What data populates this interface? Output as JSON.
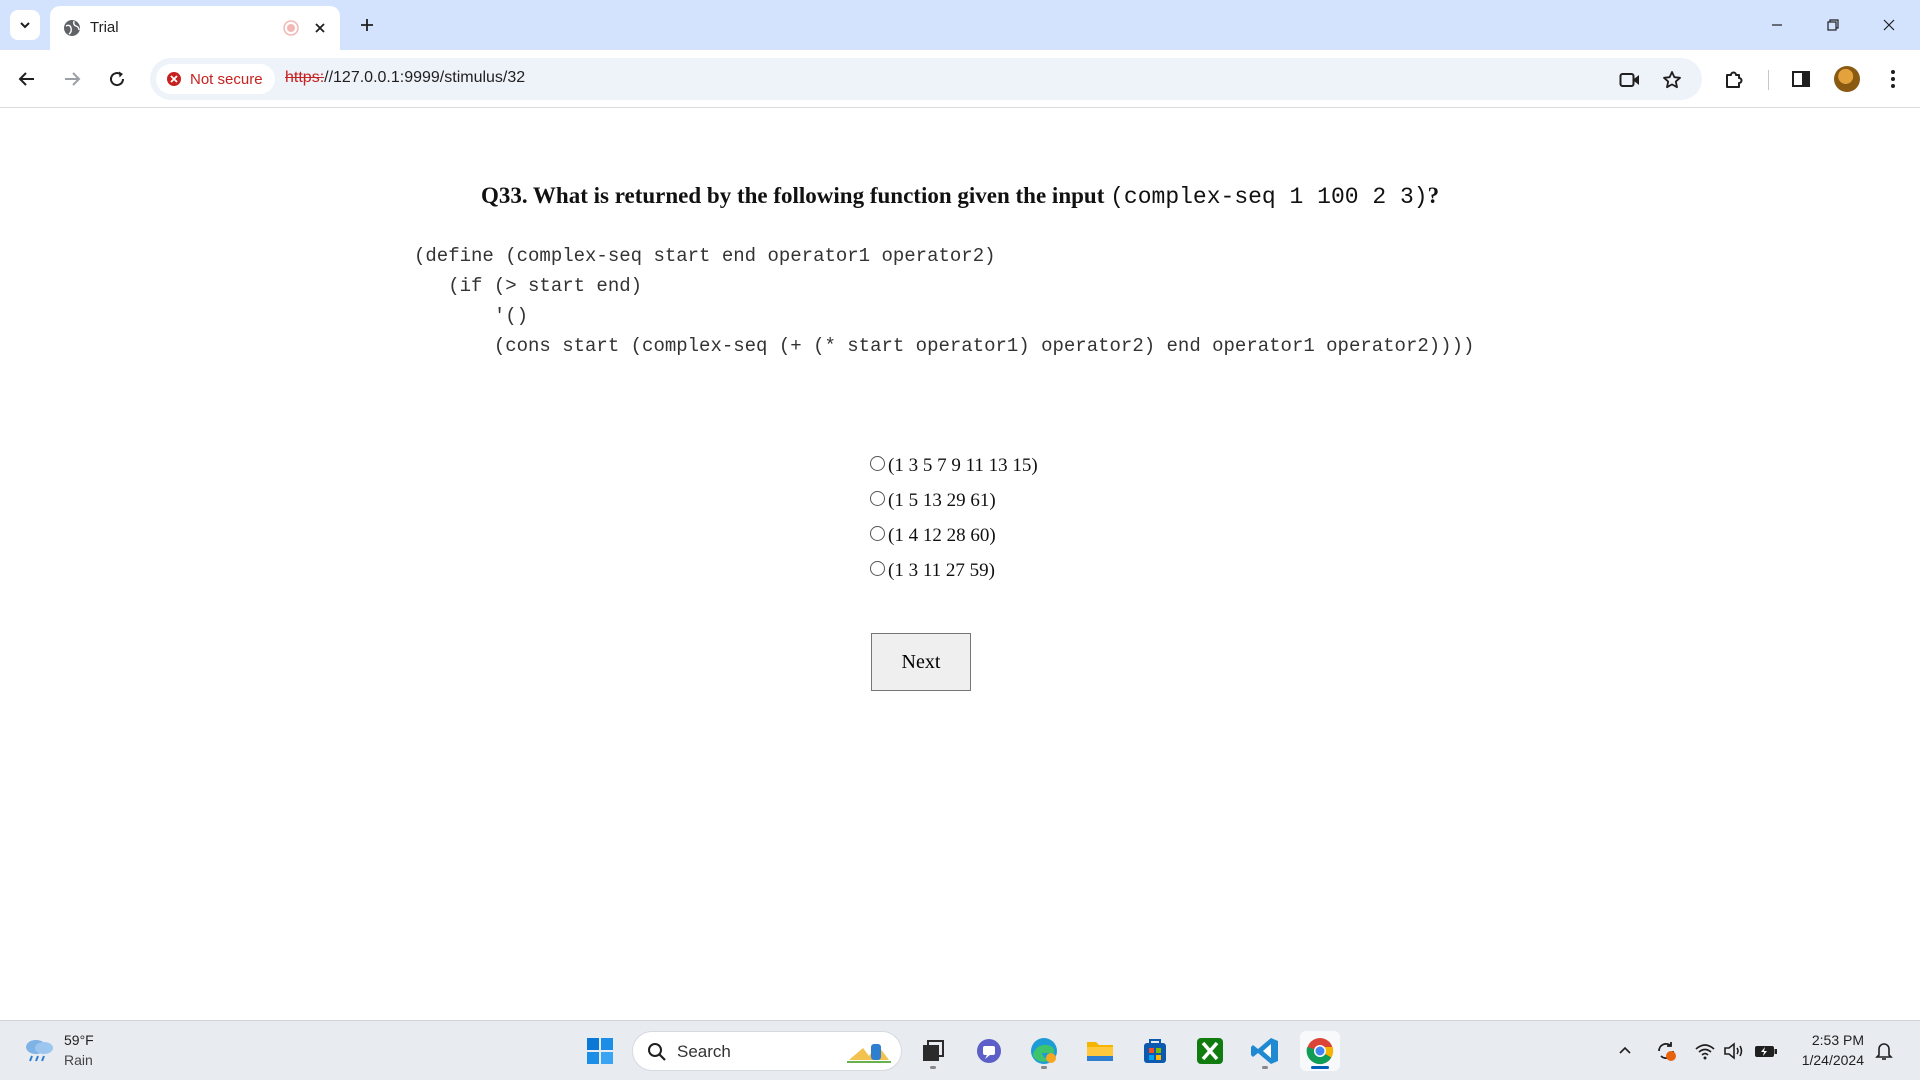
{
  "browser": {
    "tab": {
      "title": "Trial"
    },
    "omnibox": {
      "security_label": "Not secure",
      "url_scheme": "https:",
      "url_rest": "//127.0.0.1:9999/stimulus/32"
    }
  },
  "question": {
    "prefix": "Q33. What is returned by the following function given the input",
    "input_code": "(complex-seq 1 100 2 3)",
    "suffix": "?",
    "code_lines": [
      "(define (complex-seq start end operator1 operator2)",
      "   (if (> start end)",
      "       '()",
      "       (cons start (complex-seq (+ (* start operator1) operator2) end operator1 operator2))))"
    ],
    "options": [
      "(1 3 5 7 9 11 13 15)",
      "(1 5 13 29 61)",
      "(1 4 12 28 60)",
      "(1 3 11 27 59)"
    ],
    "next_label": "Next"
  },
  "taskbar": {
    "weather": {
      "temp": "59°F",
      "desc": "Rain"
    },
    "search_label": "Search",
    "clock": {
      "time": "2:53 PM",
      "date": "1/24/2024"
    }
  },
  "colors": {
    "tabstrip": "#d3e3fd",
    "not_secure_red": "#c5221f",
    "taskbar": "#e8ecf1",
    "accent": "#005fb8"
  }
}
